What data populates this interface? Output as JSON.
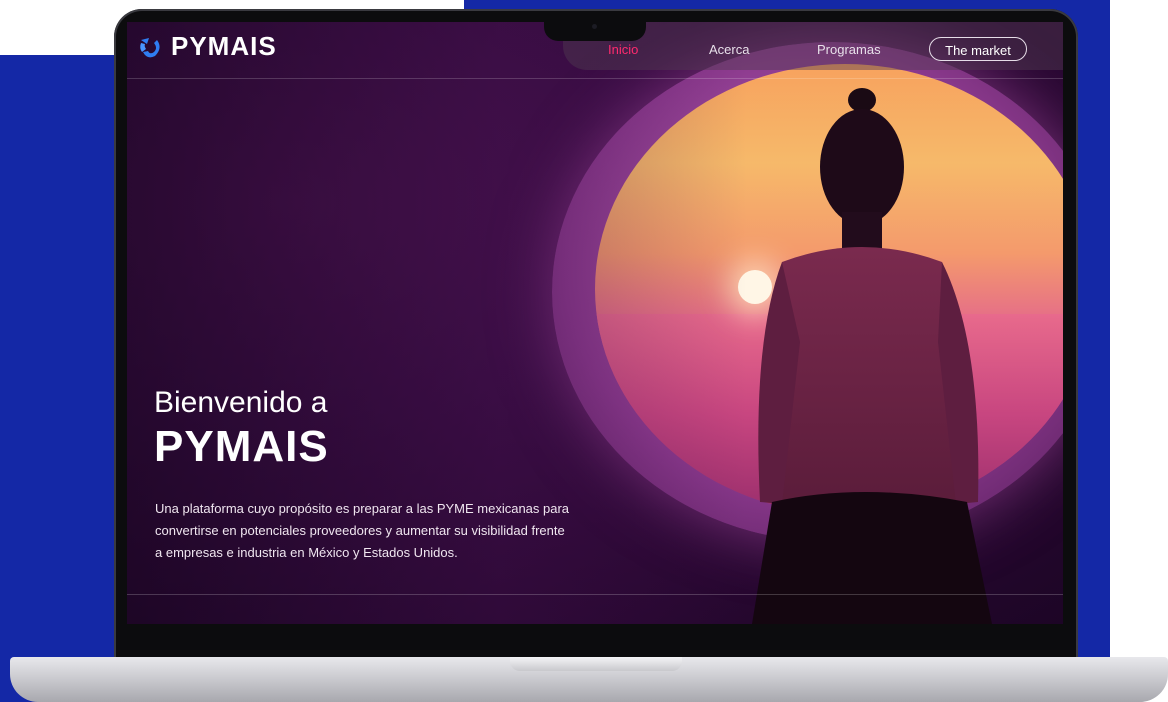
{
  "brand": {
    "name": "PYMAIS",
    "logo_icon": "pymais-logo-icon"
  },
  "nav": {
    "links": [
      {
        "label": "Inicio",
        "active": true
      },
      {
        "label": "Acerca",
        "active": false
      },
      {
        "label": "Programas",
        "active": false
      }
    ],
    "cta_label": "The market"
  },
  "hero": {
    "title_line1": "Bienvenido a",
    "title_line2": "PYMAIS",
    "description": "Una plataforma cuyo propósito es preparar a las PYME mexicanas para convertirse en potenciales proveedores y aumentar su visibilidad frente a empresas e industria en México y Estados Unidos."
  },
  "colors": {
    "page_background": "#1428a6",
    "active_link": "#ff2a6e",
    "screen_base": "#3a0d44"
  }
}
